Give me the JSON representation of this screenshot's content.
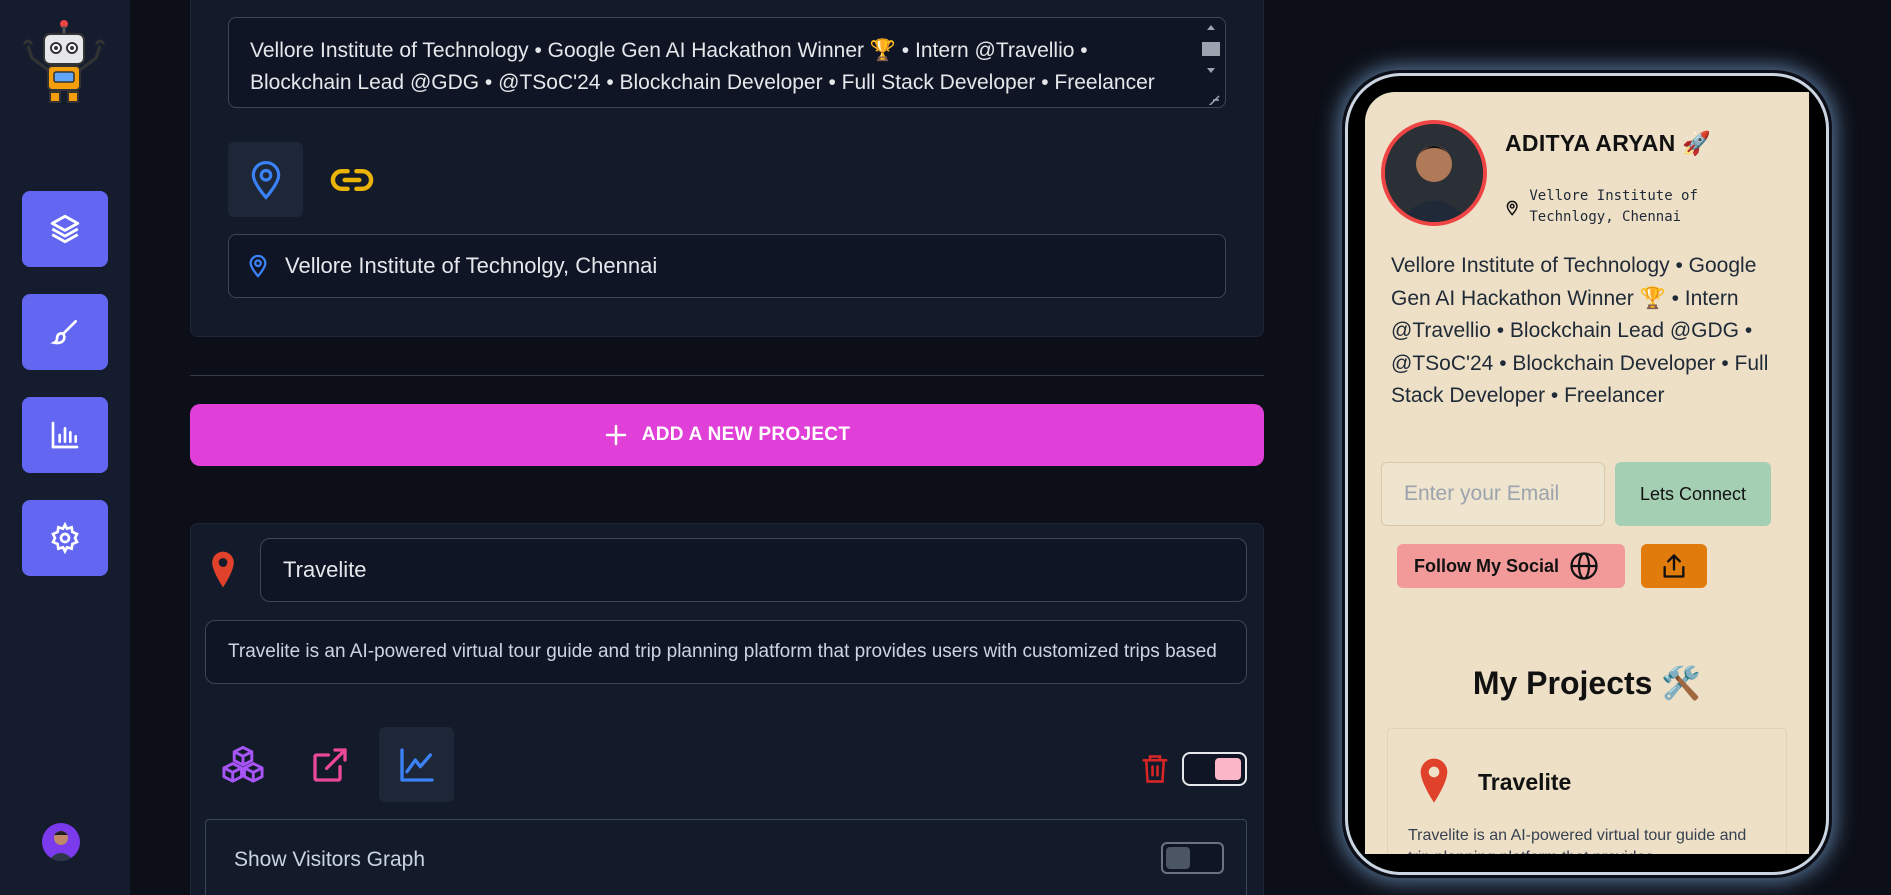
{
  "colors": {
    "sidebar_bg": "#141c2e",
    "accent_indigo": "#6366f1",
    "add_button": "#e03fd8",
    "phone_bg": "#ede0c6"
  },
  "sidebar": {
    "logo": "robot-logo",
    "items": [
      {
        "icon": "layers-icon"
      },
      {
        "icon": "brush-icon"
      },
      {
        "icon": "bar-chart-icon"
      },
      {
        "icon": "gear-icon"
      }
    ]
  },
  "editor": {
    "bio_value": "Vellore Institute of Technology • Google Gen AI Hackathon Winner 🏆  • Intern @Travellio • Blockchain Lead @GDG • @TSoC'24 • Blockchain Developer • Full Stack Developer • Freelancer",
    "location_value": "Vellore Institute of Technolgy, Chennai",
    "add_project_label": "ADD A NEW PROJECT",
    "project": {
      "name_value": "Travelite",
      "description_value": "Travelite is an AI-powered virtual tour guide and trip planning platform that provides users with customized trips based",
      "visitors_label": "Show Visitors Graph"
    }
  },
  "preview": {
    "name": "ADITYA ARYAN 🚀",
    "location": "Vellore Institute of Technlogy, Chennai",
    "bio": "Vellore Institute of Technology • Google Gen AI Hackathon Winner 🏆 • Intern @Travellio • Blockchain Lead @GDG • @TSoC'24 • Blockchain Developer • Full Stack Developer • Freelancer",
    "email_placeholder": "Enter your Email",
    "connect_label": "Lets Connect",
    "follow_label": "Follow My Social",
    "projects_heading": "My Projects 🛠️",
    "project_title": "Travelite",
    "project_desc": "Travelite is an AI-powered virtual tour guide and trip planning platform that provides"
  }
}
